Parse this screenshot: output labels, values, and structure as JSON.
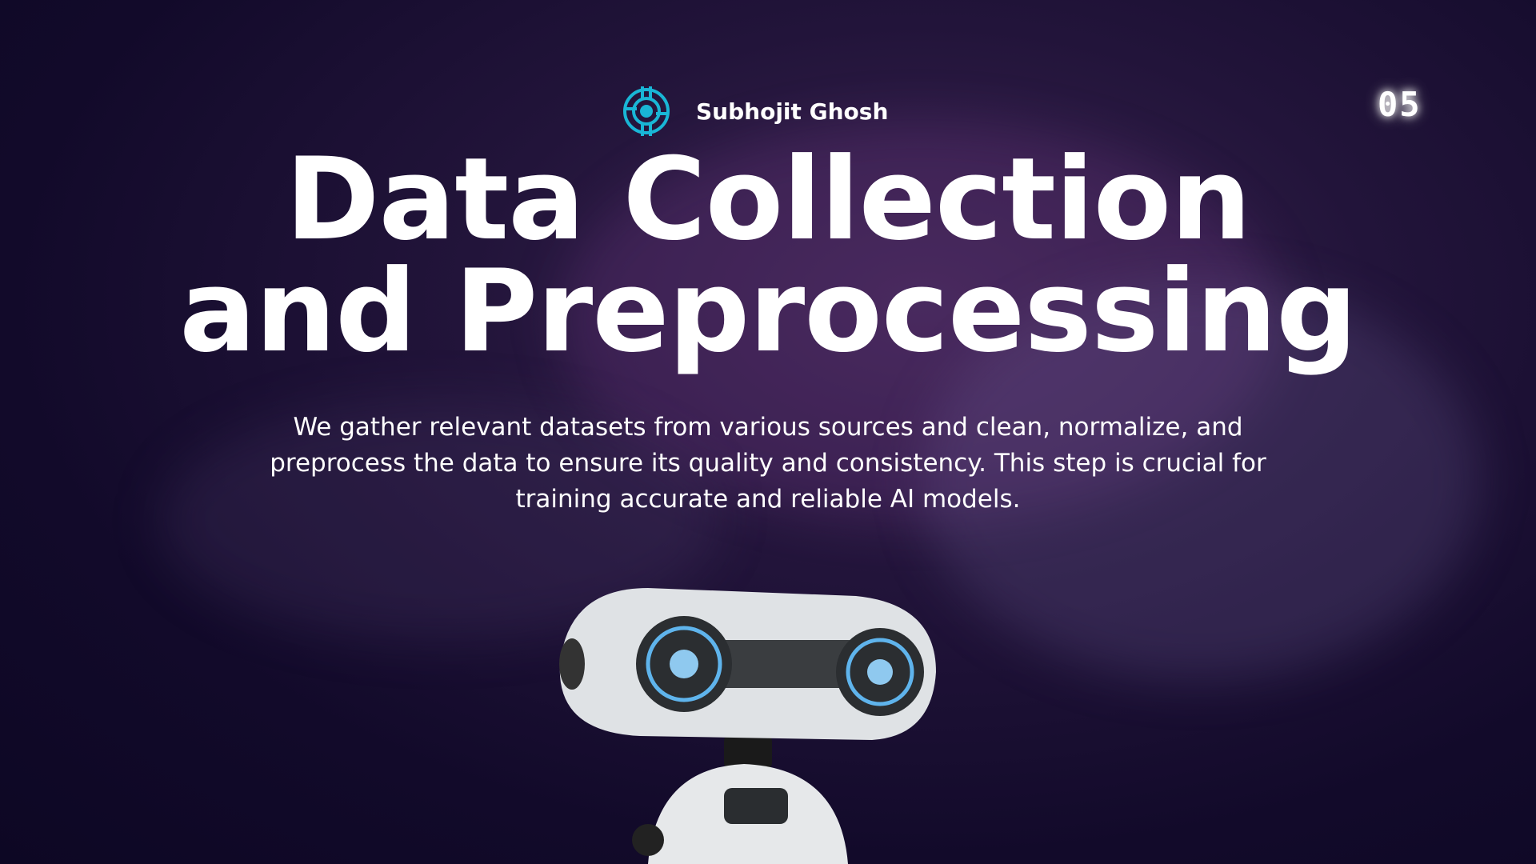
{
  "brand": {
    "name": "Subhojit Ghosh",
    "logo_icon": "target-circuit-icon",
    "accent": "#19b6d6"
  },
  "page_number": "05",
  "title": {
    "line1": "Data Collection",
    "line2": "and Preprocessing"
  },
  "description": "We gather relevant datasets from various sources and clean, normalize, and preprocess the data to ensure its quality and consistency. This step is crucial for training accurate and reliable AI models.",
  "illustration": "robot-icon"
}
